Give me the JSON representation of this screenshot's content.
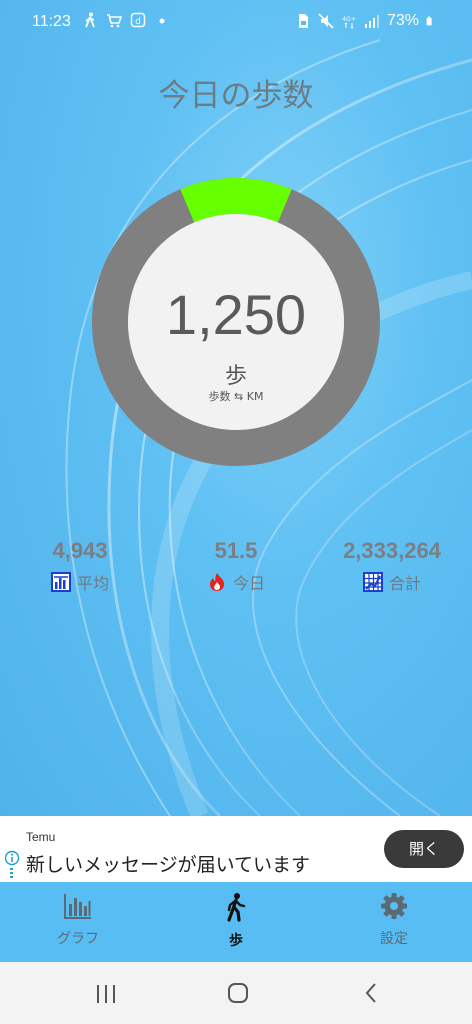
{
  "status_bar": {
    "time": "11:23",
    "battery": "73%",
    "icons_left": [
      "walking-icon",
      "cart-icon",
      "d-app-icon",
      "dot-icon"
    ],
    "icons_right": [
      "sim-icon",
      "mute-icon",
      "4g-icon",
      "signal-icon",
      "battery-icon"
    ]
  },
  "title": "今日の歩数",
  "steps": {
    "value": "1,250",
    "unit": "歩",
    "toggle": "歩数 ⇆ KM",
    "progress": 0.1264,
    "colors": {
      "progress": "#66ff00",
      "track": "#808080",
      "center": "#f2f2f2"
    }
  },
  "stats": {
    "average": {
      "value": "4,943",
      "label": "平均",
      "icon": "average-chart-icon"
    },
    "today": {
      "value": "51.5",
      "label": "今日",
      "icon": "fire-icon"
    },
    "total": {
      "value": "2,333,264",
      "label": "合計",
      "icon": "total-grid-icon"
    }
  },
  "ad": {
    "advertiser": "Temu",
    "message": "新しいメッセージが届いています",
    "open_label": "開く"
  },
  "bottom_nav": {
    "items": [
      {
        "label": "グラフ",
        "icon": "bar-chart-icon",
        "active": false
      },
      {
        "label": "歩",
        "icon": "walking-icon",
        "active": true
      },
      {
        "label": "設定",
        "icon": "gear-icon",
        "active": false
      }
    ]
  },
  "system_nav": [
    "recent-apps-icon",
    "home-icon",
    "back-icon"
  ]
}
